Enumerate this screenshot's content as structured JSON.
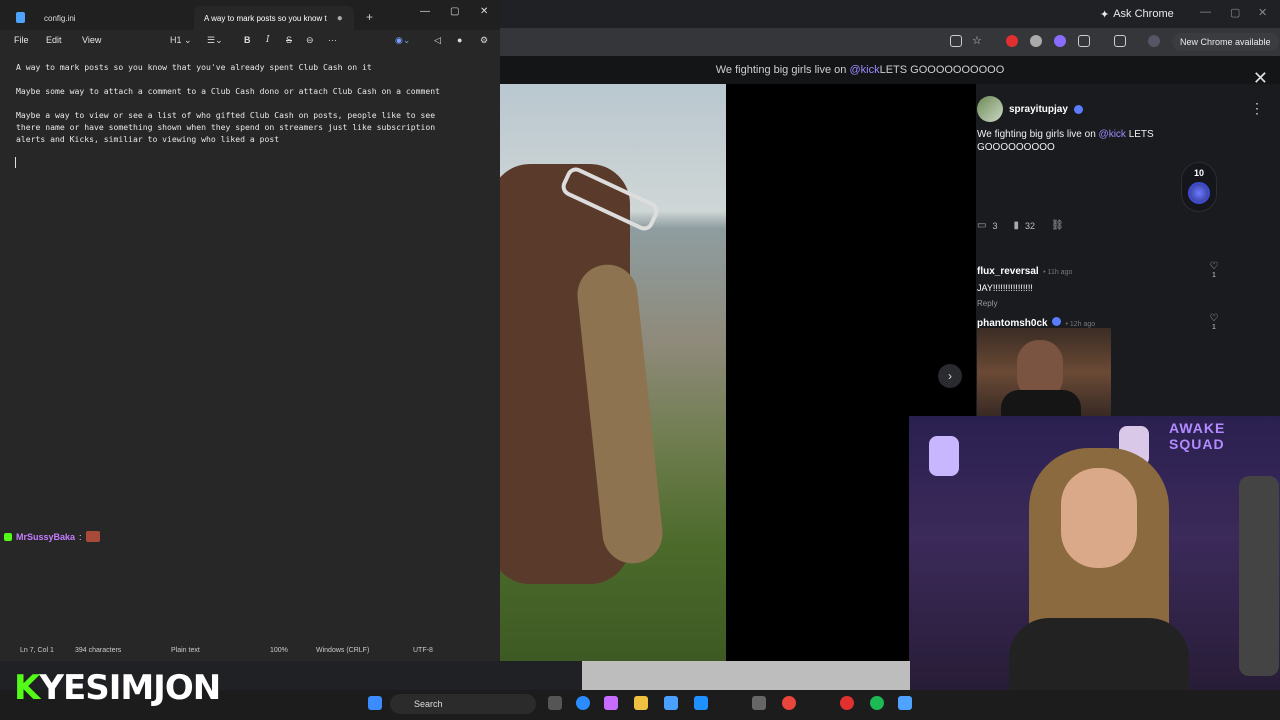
{
  "chrome": {
    "ask_chrome": "Ask Chrome",
    "new_chrome": "New Chrome available"
  },
  "kick": {
    "header_text": "We fighting big girls live on ",
    "header_mention": "@kick",
    "header_tail": " LETS GOOOOOOOOOO",
    "author": "sprayitupjay",
    "post_text_a": "We fighting big girls live on ",
    "post_mention": "@kick",
    "post_text_b": " LETS GOOOOOOOOO",
    "badge_count": "10",
    "comments_count": "3",
    "views_count": "32",
    "comments": [
      {
        "user": "flux_reversal",
        "ago": "• 11h ago",
        "text": "JAY!!!!!!!!!!!!!!!!",
        "reply": "Reply",
        "likes": "1"
      },
      {
        "user": "phantomsh0ck",
        "ago": "• 12h ago",
        "likes": "1"
      }
    ]
  },
  "notepad": {
    "tabs": [
      "config.ini",
      "A way to mark posts so you know t"
    ],
    "menus": [
      "File",
      "Edit",
      "View"
    ],
    "heading_label": "H1",
    "lines": [
      "A way to mark posts so you know that you've already spent Club Cash on it",
      "Maybe some way to attach a comment to a Club Cash dono or attach Club Cash on a comment",
      "Maybe a way to view or see a list of who gifted Club Cash on posts, people like to see",
      "there name or have something shown when they spend on streamers just like subscription",
      "alerts and Kicks, similiar to viewing who liked a post"
    ],
    "status": {
      "position": "Ln 7, Col 1",
      "chars": "394 characters",
      "format": "Plain text",
      "zoom": "100%",
      "eol": "Windows (CRLF)",
      "encoding": "UTF-8"
    }
  },
  "chat": {
    "user": "MrSussyBaka",
    "sep": ":"
  },
  "webcam": {
    "sign": "AWAKE SQUAD"
  },
  "stream_logo": {
    "k": "K",
    "rest": "YESIMJON"
  },
  "taskbar": {
    "search": "Search"
  }
}
